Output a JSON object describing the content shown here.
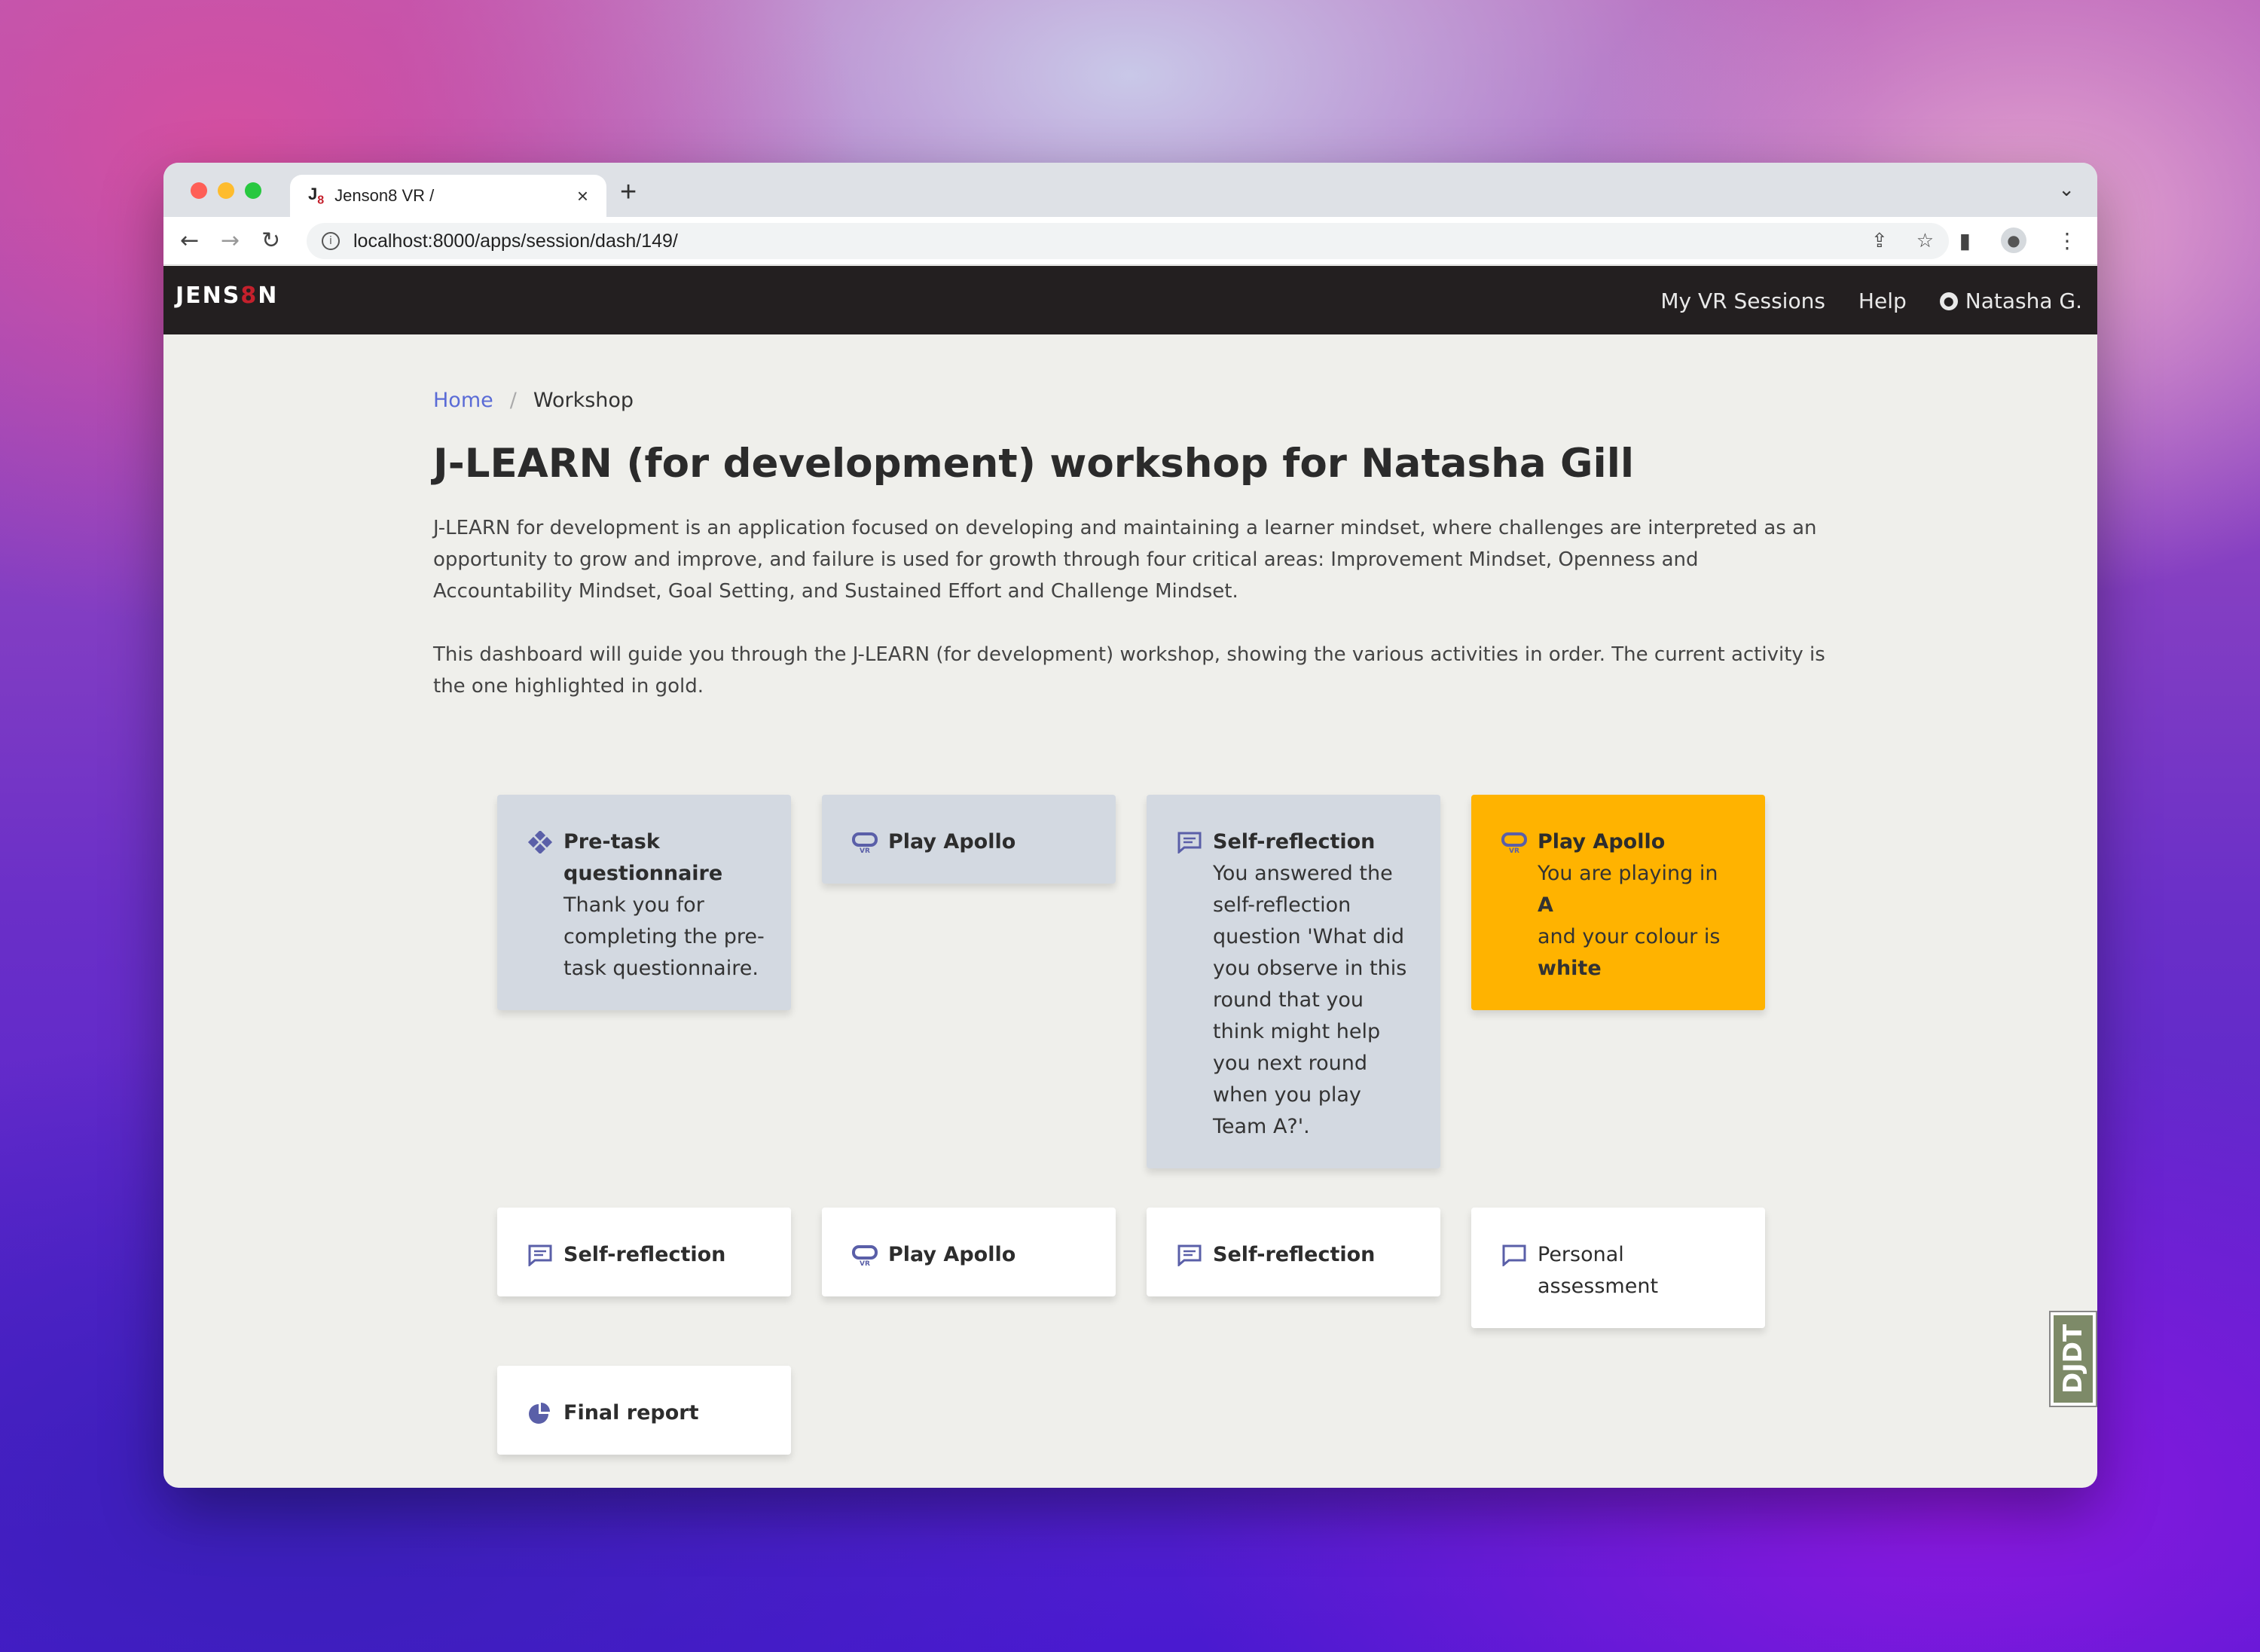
{
  "browser": {
    "tab_favicon": "J",
    "tab_favicon_sub": "8",
    "tab_title": "Jenson8 VR /",
    "tab_close": "×",
    "new_tab": "+",
    "tab_menu": "⌄",
    "url": "localhost:8000/apps/session/dash/149/",
    "back": "←",
    "forward": "→",
    "reload": "↻",
    "share_icon": "⇪",
    "star_icon": "☆",
    "sidepanel_icon": "▮",
    "menu_icon": "⋮"
  },
  "appnav": {
    "brand_left": "JENS",
    "brand_eight": "8",
    "brand_right": "N",
    "links": {
      "sessions": "My VR Sessions",
      "help": "Help",
      "user": "Natasha G."
    }
  },
  "breadcrumb": {
    "home": "Home",
    "separator": "/",
    "current": "Workshop"
  },
  "page": {
    "title": "J-LEARN (for development) workshop for Natasha Gill",
    "description_1": "J-LEARN for development is an application focused on developing and maintaining a learner mindset, where challenges are interpreted as an opportunity to grow and improve, and failure is used for growth through four critical areas: Improvement Mindset, Openness and Accountability Mindset, Goal Setting, and Sustained Effort and Challenge Mindset.",
    "description_2": "This dashboard will guide you through the J-LEARN (for development) workshop, showing the various activities in order. The current activity is the one highlighted in gold."
  },
  "colors": {
    "completed": "#d3d9e1",
    "current": "#ffb300",
    "upcoming": "#ffffff",
    "icon": "#5a5fa8"
  },
  "activities": [
    {
      "title": "Pre-task questionnaire",
      "body": "Thank you for completing the pre-task questionnaire.",
      "icon": "questionnaire-icon",
      "status": "completed"
    },
    {
      "title": "Play Apollo",
      "body": "",
      "icon": "vr-headset-icon",
      "status": "completed"
    },
    {
      "title": "Self-reflection",
      "body": "You answered the self-reflection question 'What did you observe in this round that you think might help you next round when you play Team A?'.",
      "icon": "comment-icon",
      "status": "completed"
    },
    {
      "title": "Play Apollo",
      "body_prefix": "You are playing in",
      "team": "A",
      "body_mid": "and your colour is",
      "colour": "white",
      "icon": "vr-headset-icon",
      "status": "current"
    },
    {
      "title": "Self-reflection",
      "icon": "comment-icon",
      "status": "upcoming"
    },
    {
      "title": "Play Apollo",
      "icon": "vr-headset-icon",
      "status": "upcoming"
    },
    {
      "title": "Self-reflection",
      "icon": "comment-icon",
      "status": "upcoming"
    },
    {
      "title": "Personal assessment",
      "icon": "speech-bubble-icon",
      "status": "upcoming"
    },
    {
      "title": "Final report",
      "icon": "pie-chart-icon",
      "status": "upcoming"
    }
  ],
  "debug_toolbar": "DJDT"
}
